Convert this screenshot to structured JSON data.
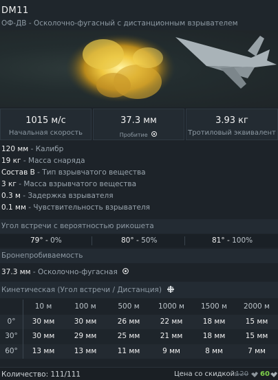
{
  "shell": {
    "name": "DM11",
    "type": "ОФ-ДВ",
    "description": "Осколочно-фугасный с дистанционным взрывателем"
  },
  "stats": [
    {
      "value": "1015 м/с",
      "label": "Начальная скорость"
    },
    {
      "value": "37.3 мм",
      "label": "Пробитие"
    },
    {
      "value": "3.93 кг",
      "label": "Тротиловый эквивалент"
    }
  ],
  "params": [
    {
      "value": "120 мм",
      "label": "Калибр"
    },
    {
      "value": "19 кг",
      "label": "Масса снаряда"
    },
    {
      "value": "Состав B",
      "label": "Тип взрывчатого вещества"
    },
    {
      "value": "3 кг",
      "label": "Масса взрывчатого вещества"
    },
    {
      "value": "0.3 м",
      "label": "Задержка взрывателя"
    },
    {
      "value": "0.1 мм",
      "label": "Чувствительность взрывателя"
    }
  ],
  "ricochet": {
    "title": "Угол встречи с вероятностью рикошета",
    "items": [
      {
        "angle": "79°",
        "chance": "0%"
      },
      {
        "angle": "80°",
        "chance": "50%"
      },
      {
        "angle": "81°",
        "chance": "100%"
      }
    ]
  },
  "penetration": {
    "title": "Бронепробиваемость",
    "value": "37.3 мм",
    "label": "Осколочно-фугасная"
  },
  "kinetic": {
    "title": "Кинетическая (Угол встречи / Дистанция)",
    "distances": [
      "10 м",
      "100 м",
      "500 м",
      "1000 м",
      "1500 м",
      "2000 м"
    ],
    "rows": [
      {
        "angle": "0°",
        "values": [
          "30 мм",
          "30 мм",
          "26 мм",
          "22 мм",
          "18 мм",
          "15 мм"
        ]
      },
      {
        "angle": "30°",
        "values": [
          "30 мм",
          "29 мм",
          "25 мм",
          "21 мм",
          "18 мм",
          "15 мм"
        ]
      },
      {
        "angle": "60°",
        "values": [
          "13 мм",
          "13 мм",
          "11 мм",
          "9 мм",
          "8 мм",
          "7 мм"
        ]
      }
    ]
  },
  "footer": {
    "quantity": "Количество: 111/111",
    "price_label": "Цена со скидкой:",
    "price_old": "120",
    "price_new": "60"
  },
  "colors": {
    "accent_green": "#7ed04a",
    "explosion": "#e7c23a"
  }
}
